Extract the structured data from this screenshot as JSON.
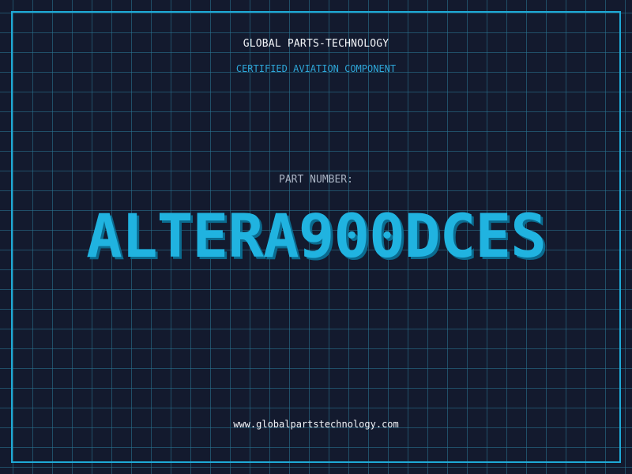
{
  "header": {
    "company": "GLOBAL PARTS-TECHNOLOGY",
    "certification": "CERTIFIED AVIATION COMPONENT"
  },
  "part": {
    "label": "PART NUMBER:",
    "number": "ALTERA900DCES"
  },
  "footer": {
    "website": "www.globalpartstechnology.com"
  },
  "colors": {
    "background": "#131a2e",
    "grid": "#297896",
    "accent": "#1ea9d6",
    "text": "#f2f4f8"
  }
}
